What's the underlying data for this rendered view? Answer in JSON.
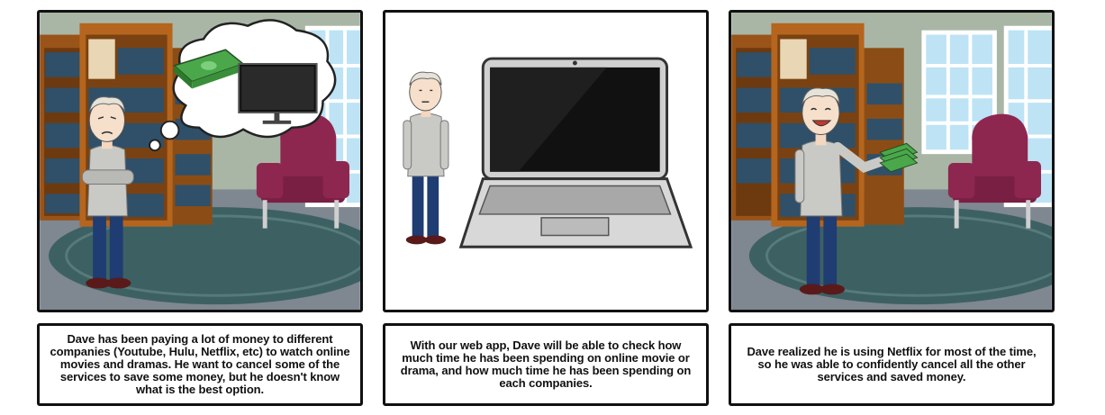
{
  "panels": [
    {
      "caption": "Dave has been paying a lot of money to different companies (Youtube, Hulu, Netflix, etc) to watch online movies and dramas. He want to cancel some of the services to save some money,  but he doesn't know what is the best option."
    },
    {
      "caption": "With our web app, Dave will be able to check how much time he has been spending on online movie or drama, and how much time he has been spending on each companies."
    },
    {
      "caption": "Dave realized he is using Netflix for most of the time, so he was able to confidently cancel all the other services and saved money."
    }
  ],
  "icons": [
    "money-stack-icon",
    "tv-monitor-icon",
    "laptop-icon",
    "armchair-icon",
    "bookshelf-icon",
    "window-icon"
  ],
  "colors": {
    "wall": "#a9b6a6",
    "rug": "#3d6163",
    "shelf": "#b5651d",
    "books": "#2f5068",
    "chair": "#8e2750",
    "shirt": "#c9cac6",
    "jeans": "#1f3c73",
    "money": "#4aa84a"
  }
}
